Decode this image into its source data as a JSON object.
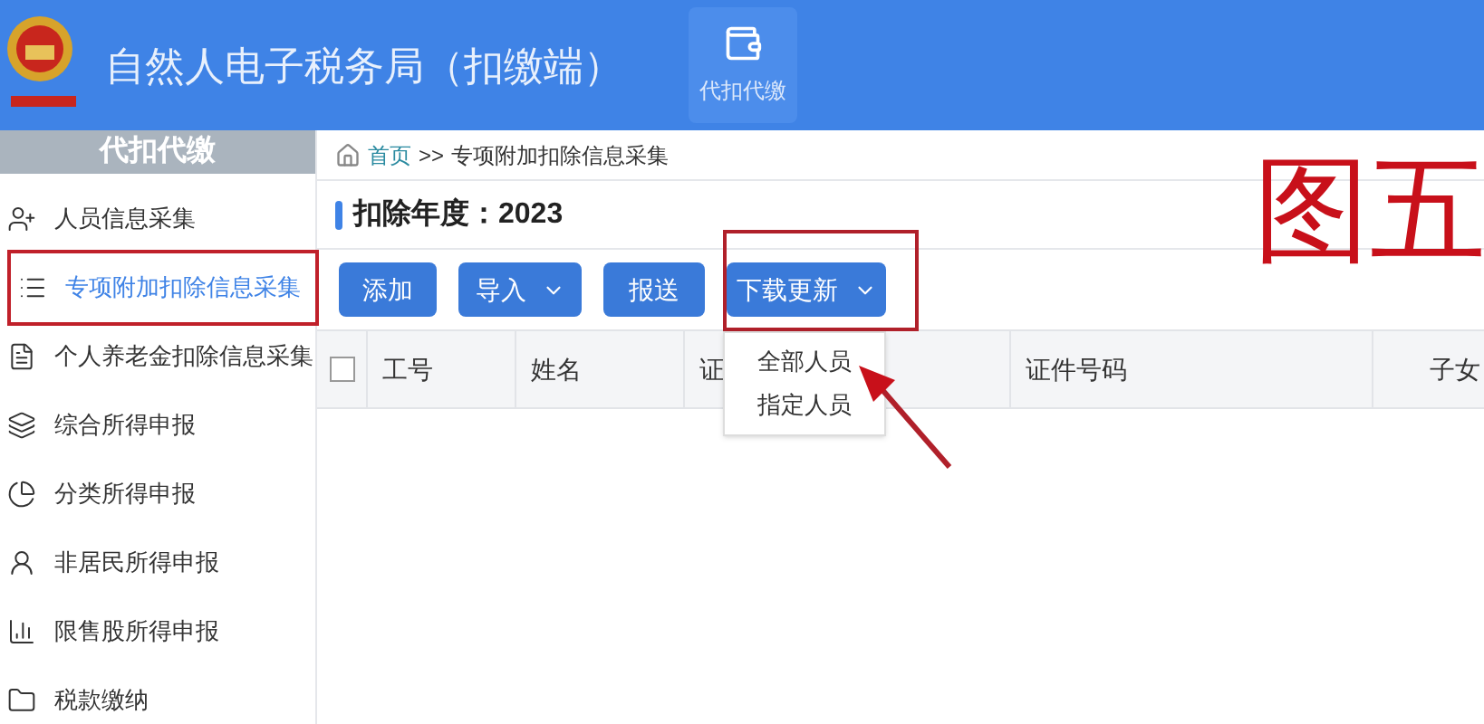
{
  "header": {
    "title": "自然人电子税务局（扣缴端）",
    "nav": [
      {
        "label": "代扣代缴",
        "selected": true
      }
    ]
  },
  "sidebar": {
    "heading": "代扣代缴",
    "items": [
      {
        "label": "人员信息采集",
        "selected": false,
        "annotated": false
      },
      {
        "label": "专项附加扣除信息采集",
        "selected": true,
        "annotated": true
      },
      {
        "label": "个人养老金扣除信息采集",
        "selected": false,
        "annotated": false
      },
      {
        "label": "综合所得申报",
        "selected": false,
        "annotated": false
      },
      {
        "label": "分类所得申报",
        "selected": false,
        "annotated": false
      },
      {
        "label": "非居民所得申报",
        "selected": false,
        "annotated": false
      },
      {
        "label": "限售股所得申报",
        "selected": false,
        "annotated": false
      },
      {
        "label": "税款缴纳",
        "selected": false,
        "annotated": false
      }
    ]
  },
  "breadcrumb": {
    "home": "首页",
    "separator": ">>",
    "current": "专项附加扣除信息采集"
  },
  "year_title": "扣除年度：2023",
  "buttons": [
    {
      "label": "添加",
      "caret": false,
      "annotated": false
    },
    {
      "label": "导入",
      "caret": true,
      "annotated": false
    },
    {
      "label": "报送",
      "caret": false,
      "annotated": false
    },
    {
      "label": "下载更新",
      "caret": true,
      "annotated": true,
      "menu": [
        {
          "label": "全部人员",
          "pointed": true
        },
        {
          "label": "指定人员",
          "pointed": false
        }
      ]
    }
  ],
  "table": {
    "select_all": {
      "checked": false
    },
    "columns": [
      "工号",
      "姓名",
      "证",
      "证件号码",
      "子女"
    ]
  },
  "annotation": {
    "label": "图五"
  }
}
